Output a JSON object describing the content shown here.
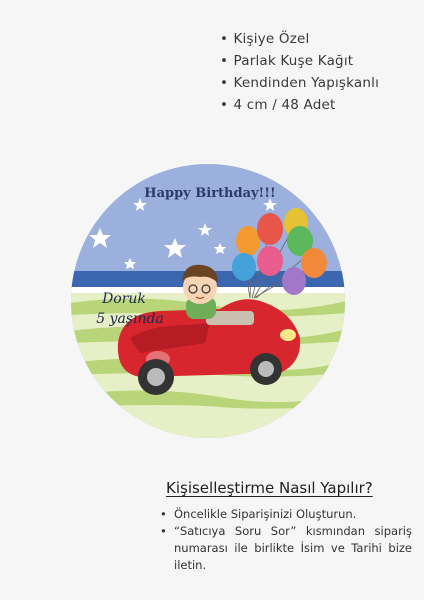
{
  "features": [
    "Kişiye Özel",
    "Parlak Kuşe Kağıt",
    "Kendinden Yapışkanlı",
    "4 cm / 48 Adet"
  ],
  "sticker": {
    "greeting": "Happy Birthday!!!",
    "name": "Doruk",
    "age_text": "5 yaşında"
  },
  "instructions": {
    "heading": "Kişiselleştirme Nasıl Yapılır?",
    "steps": [
      " Öncelikle Siparişinizi Oluşturun.",
      "“Satıcıya Soru Sor” kısmından sipariş numarası ile birlikte İsim ve Tarihi bize iletin."
    ]
  }
}
